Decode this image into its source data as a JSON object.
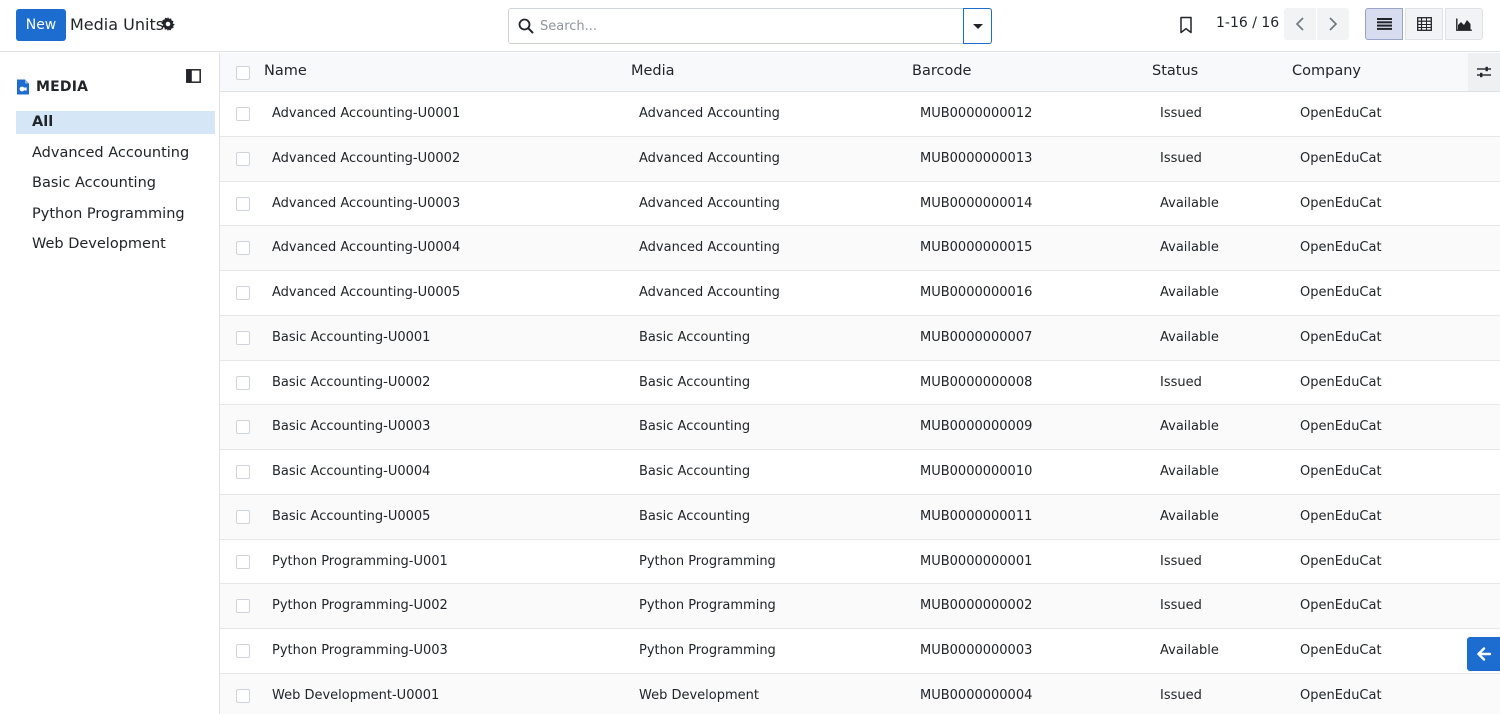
{
  "control_panel": {
    "new_label": "New",
    "title": "Media Units",
    "search_placeholder": "Search...",
    "pager": "1-16 / 16"
  },
  "sidebar": {
    "title": "MEDIA",
    "items": [
      {
        "label": "All",
        "active": true
      },
      {
        "label": "Advanced Accounting",
        "active": false
      },
      {
        "label": "Basic Accounting",
        "active": false
      },
      {
        "label": "Python Programming",
        "active": false
      },
      {
        "label": "Web Development",
        "active": false
      }
    ]
  },
  "table": {
    "columns": [
      "Name",
      "Media",
      "Barcode",
      "Status",
      "Company"
    ],
    "rows": [
      [
        "Advanced Accounting-U0001",
        "Advanced Accounting",
        "MUB0000000012",
        "Issued",
        "OpenEduCat"
      ],
      [
        "Advanced Accounting-U0002",
        "Advanced Accounting",
        "MUB0000000013",
        "Issued",
        "OpenEduCat"
      ],
      [
        "Advanced Accounting-U0003",
        "Advanced Accounting",
        "MUB0000000014",
        "Available",
        "OpenEduCat"
      ],
      [
        "Advanced Accounting-U0004",
        "Advanced Accounting",
        "MUB0000000015",
        "Available",
        "OpenEduCat"
      ],
      [
        "Advanced Accounting-U0005",
        "Advanced Accounting",
        "MUB0000000016",
        "Available",
        "OpenEduCat"
      ],
      [
        "Basic Accounting-U0001",
        "Basic Accounting",
        "MUB0000000007",
        "Available",
        "OpenEduCat"
      ],
      [
        "Basic Accounting-U0002",
        "Basic Accounting",
        "MUB0000000008",
        "Issued",
        "OpenEduCat"
      ],
      [
        "Basic Accounting-U0003",
        "Basic Accounting",
        "MUB0000000009",
        "Available",
        "OpenEduCat"
      ],
      [
        "Basic Accounting-U0004",
        "Basic Accounting",
        "MUB0000000010",
        "Available",
        "OpenEduCat"
      ],
      [
        "Basic Accounting-U0005",
        "Basic Accounting",
        "MUB0000000011",
        "Available",
        "OpenEduCat"
      ],
      [
        "Python Programming-U001",
        "Python Programming",
        "MUB0000000001",
        "Issued",
        "OpenEduCat"
      ],
      [
        "Python Programming-U002",
        "Python Programming",
        "MUB0000000002",
        "Issued",
        "OpenEduCat"
      ],
      [
        "Python Programming-U003",
        "Python Programming",
        "MUB0000000003",
        "Available",
        "OpenEduCat"
      ],
      [
        "Web Development-U0001",
        "Web Development",
        "MUB0000000004",
        "Issued",
        "OpenEduCat"
      ]
    ]
  },
  "icons": {
    "gear": "gear-icon",
    "search": "search-icon",
    "bookmark": "bookmark-icon",
    "list_view": "list-view-icon",
    "pivot_view": "pivot-view-icon",
    "graph_view": "graph-view-icon",
    "collapse": "sidebar-collapse-icon",
    "media": "media-icon",
    "optional_columns": "sliders-icon",
    "back": "arrow-left-icon"
  },
  "colors": {
    "primary": "#1d6ccf",
    "active_filter_bg": "#d5e7f7"
  }
}
